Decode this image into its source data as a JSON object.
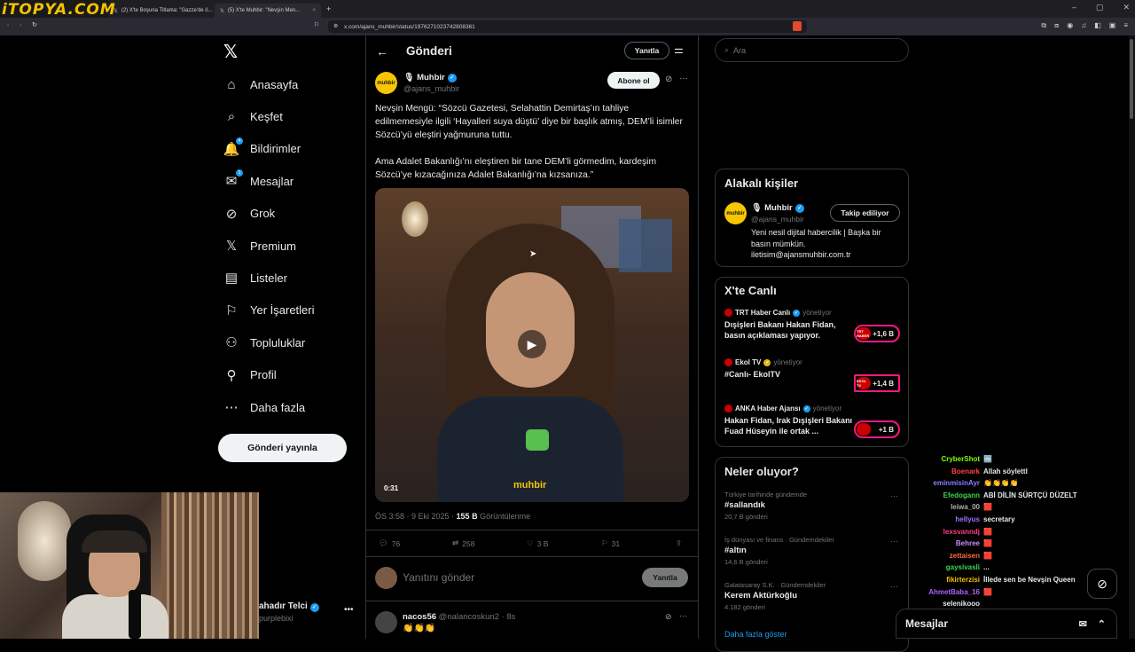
{
  "browser": {
    "logo_text": "iTOPYA.COM",
    "tabs": [
      {
        "label": "(2) X'te Boşuna Titlama: \"Gazze'de ö...",
        "active": false
      },
      {
        "label": "(5) X'te Muhbir: \"Nevşin Men...",
        "active": true
      }
    ],
    "new_tab": "+",
    "url": "x.com/ajans_muhbir/status/1976271023742808361"
  },
  "sidebar": {
    "logo": "𝕏",
    "items": [
      {
        "label": "Anasayfa",
        "icon": "home-icon",
        "glyph": "⌂"
      },
      {
        "label": "Keşfet",
        "icon": "search-icon",
        "glyph": "⌕"
      },
      {
        "label": "Bildirimler",
        "icon": "bell-icon",
        "glyph": "🔔",
        "badge": "4"
      },
      {
        "label": "Mesajlar",
        "icon": "envelope-icon",
        "glyph": "✉",
        "badge": "1"
      },
      {
        "label": "Grok",
        "icon": "grok-icon",
        "glyph": "⊘"
      },
      {
        "label": "Premium",
        "icon": "x-premium-icon",
        "glyph": "𝕏"
      },
      {
        "label": "Listeler",
        "icon": "list-icon",
        "glyph": "▤"
      },
      {
        "label": "Yer İşaretleri",
        "icon": "bookmark-icon",
        "glyph": "⚐"
      },
      {
        "label": "Topluluklar",
        "icon": "communities-icon",
        "glyph": "⚇"
      },
      {
        "label": "Profil",
        "icon": "profile-icon",
        "glyph": "⚲"
      },
      {
        "label": "Daha fazla",
        "icon": "more-circle-icon",
        "glyph": "⋯"
      }
    ],
    "post_button": "Gönderi yayınla",
    "account_name": "ahadır Telci",
    "account_handle": "purplebixi"
  },
  "main": {
    "title": "Gönderi",
    "reply_button": "Yanıtla",
    "author": {
      "name": "Muhbir",
      "handle": "@ajans_muhbir",
      "avatar_text": "muhbir",
      "subscribe_label": "Abone ol"
    },
    "text_p1": "Nevşin Mengü: “Sözcü Gazetesi, Selahattin Demirtaş’ın tahliye edilmemesiyle ilgili ‘Hayalleri suya düştü’ diye bir başlık atmış, DEM’li isimler Sözcü’yü eleştiri yağmuruna tuttu.",
    "text_p2": "Ama Adalet Bakanlığı’nı eleştiren bir tane DEM’li görmedim, kardeşim Sözcü’ye kızacağınıza Adalet Bakanlığı’na kızsanıza.”",
    "video": {
      "duration": "0:31",
      "watermark": "muhbir"
    },
    "meta": {
      "time": "ÖS 3:58 · 9 Eki 2025 · ",
      "views": "155 B",
      "views_label": " Görüntülenme"
    },
    "actions": {
      "replies": "76",
      "reposts": "258",
      "likes": "3 B",
      "bookmarks": "31"
    },
    "reply_placeholder": "Yanıtını gönder",
    "reply_send": "Yanıtla",
    "first_reply": {
      "name": "nacos56",
      "handle": "@nalancoskun2 · 8s",
      "text": "👏👏👏"
    }
  },
  "right": {
    "search_placeholder": "Ara",
    "related_title": "Alakalı kişiler",
    "related": {
      "name": "Muhbir",
      "handle": "@ajans_muhbir",
      "follow_label": "Takip ediliyor",
      "bio": "Yeni nesil dijital habercilik | Başka bir basın mümkün. iletisim@ajansmuhbir.com.tr"
    },
    "live_title": "X'te Canlı",
    "live": [
      {
        "host": "TRT Haber Canlı",
        "role": "yönetiyor",
        "title": "Dışişleri Bakanı Hakan Fidan, basın açıklaması yapıyor.",
        "count": "+1,6 B",
        "chip": "TRT HABER"
      },
      {
        "host": "Ekol TV",
        "role": "yönetiyor",
        "title": "#Canlı- EkolTV",
        "count": "+1,4 B",
        "chip": "EKOL TV"
      },
      {
        "host": "ANKA Haber Ajansı",
        "role": "yönetiyor",
        "title": "Hakan Fidan, Irak Dışişleri Bakanı Fuad Hüseyin ile ortak ...",
        "count": "+1 B",
        "chip": ""
      }
    ],
    "trends_title": "Neler oluyor?",
    "trends": [
      {
        "category": "Türkiye tarihinde gündemde",
        "name": "#sallandık",
        "count": "20,7 B gönderi"
      },
      {
        "category": "İş dünyası ve finans · Gündemdekiler",
        "name": "#altın",
        "count": "14,6 B gönderi"
      },
      {
        "category": "Galatasaray S.K. · Gündemdekiler",
        "name": "Kerem Aktürkoğlu",
        "count": "4.182 gönderi"
      }
    ],
    "show_more": "Daha fazla göster"
  },
  "chat": [
    {
      "user": "CryberShot",
      "msg": "🆒",
      "color": "#7cfc00"
    },
    {
      "user": "Boenark",
      "msg": "Allah söylettl",
      "color": "#ff4040"
    },
    {
      "user": "eminmisinAyr",
      "msg": "👏👏👏👏",
      "color": "#8a7dff"
    },
    {
      "user": "Efedogann",
      "msg": "ABİ DİLİN SÜRTÇÜ DÜZELT",
      "color": "#3fd54e"
    },
    {
      "user": "leiwa_00",
      "msg": "🟥",
      "color": "#b0b0b0"
    },
    {
      "user": "hellyus",
      "msg": "secretary",
      "color": "#a070ff"
    },
    {
      "user": "lexsvanndj",
      "msg": "🟥",
      "color": "#ff3d7f"
    },
    {
      "user": "Behree",
      "msg": "🟥",
      "color": "#c98cff"
    },
    {
      "user": "zettaisen",
      "msg": "🟥",
      "color": "#ff6a3d"
    },
    {
      "user": "gaysivasli",
      "msg": "...",
      "color": "#3fd54e"
    },
    {
      "user": "fikirterzisi",
      "msg": "İllede sen be Nevşin Queen",
      "color": "#f4c200"
    },
    {
      "user": "AhmetBaba_16",
      "msg": "🟥",
      "color": "#b060ff"
    },
    {
      "user": "selenikooo",
      "msg": "",
      "color": "#e7e9ea"
    }
  ],
  "messages_bar": {
    "label": "Mesajlar"
  },
  "colors": {
    "accent": "#1d9bf0",
    "live_border": "#f91880",
    "muted": "#71767b"
  }
}
